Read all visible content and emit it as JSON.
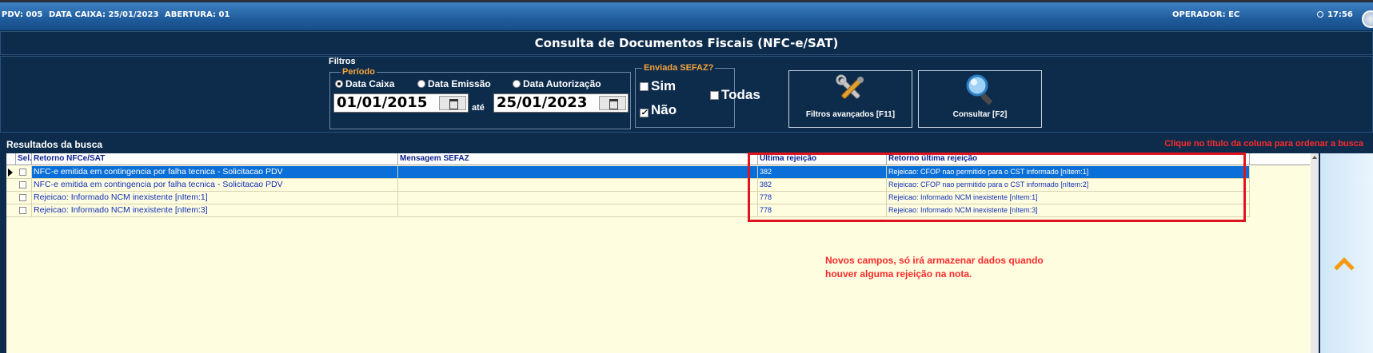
{
  "topbar": {
    "pdv": "PDV: 005",
    "data_caixa": "DATA CAIXA: 25/01/2023",
    "abertura": "ABERTURA: 01",
    "operador": "OPERADOR:  EC",
    "time": "17:56"
  },
  "title": "Consulta de Documentos Fiscais (NFC-e/SAT)",
  "filtros": {
    "label": "Filtros",
    "periodo_label": "Período",
    "periodo_options": [
      "Data Caixa",
      "Data Emissão",
      "Data Autorização"
    ],
    "periodo_selected": "Data Caixa",
    "date_from": "01/01/2015",
    "ate_label": "até",
    "date_to": "25/01/2023",
    "sefaz_label": "Enviada SEFAZ?",
    "sim_label": "Sim",
    "nao_label": "Não",
    "todas_label": "Todas",
    "sim_checked": false,
    "nao_checked": true,
    "todas_checked": false
  },
  "buttons": {
    "filtros_avancados": "Filtros avançados [F11]",
    "consultar": "Consultar [F2]"
  },
  "results": {
    "label": "Resultados da busca",
    "hint": "Clique no título da coluna para ordenar a busca",
    "columns": [
      "Sel.",
      "Retorno NFCe/SAT",
      "Mensagem SEFAZ",
      "Última rejeição",
      "Retorno última rejeição"
    ],
    "rows": [
      {
        "retorno": "NFC-e emitida em contingencia por falha tecnica - Solicitacao PDV",
        "mensagem": "",
        "ultima": "382",
        "retorno_ultima": "Rejeicao: CFOP nao permitido para o CST informado [nItem:1]",
        "selected": true
      },
      {
        "retorno": "NFC-e emitida em contingencia por falha tecnica - Solicitacao PDV",
        "mensagem": "",
        "ultima": "382",
        "retorno_ultima": "Rejeicao: CFOP nao permitido para o CST informado [nItem:2]",
        "selected": false
      },
      {
        "retorno": "Rejeicao: Informado NCM inexistente [nItem:1]",
        "mensagem": "",
        "ultima": "778",
        "retorno_ultima": "Rejeicao: Informado NCM inexistente [nItem:1]",
        "selected": false
      },
      {
        "retorno": "Rejeicao: Informado NCM inexistente [nItem:3]",
        "mensagem": "",
        "ultima": "778",
        "retorno_ultima": "Rejeicao: Informado NCM inexistente [nItem:3]",
        "selected": false
      }
    ]
  },
  "annotation": "Novos campos, só irá armazenar dados quando\nhouver alguma rejeição na nota.",
  "colors": {
    "accent_orange": "#f5a23a",
    "highlight_red": "#e0141e",
    "selection_blue": "#0a6fd8"
  }
}
